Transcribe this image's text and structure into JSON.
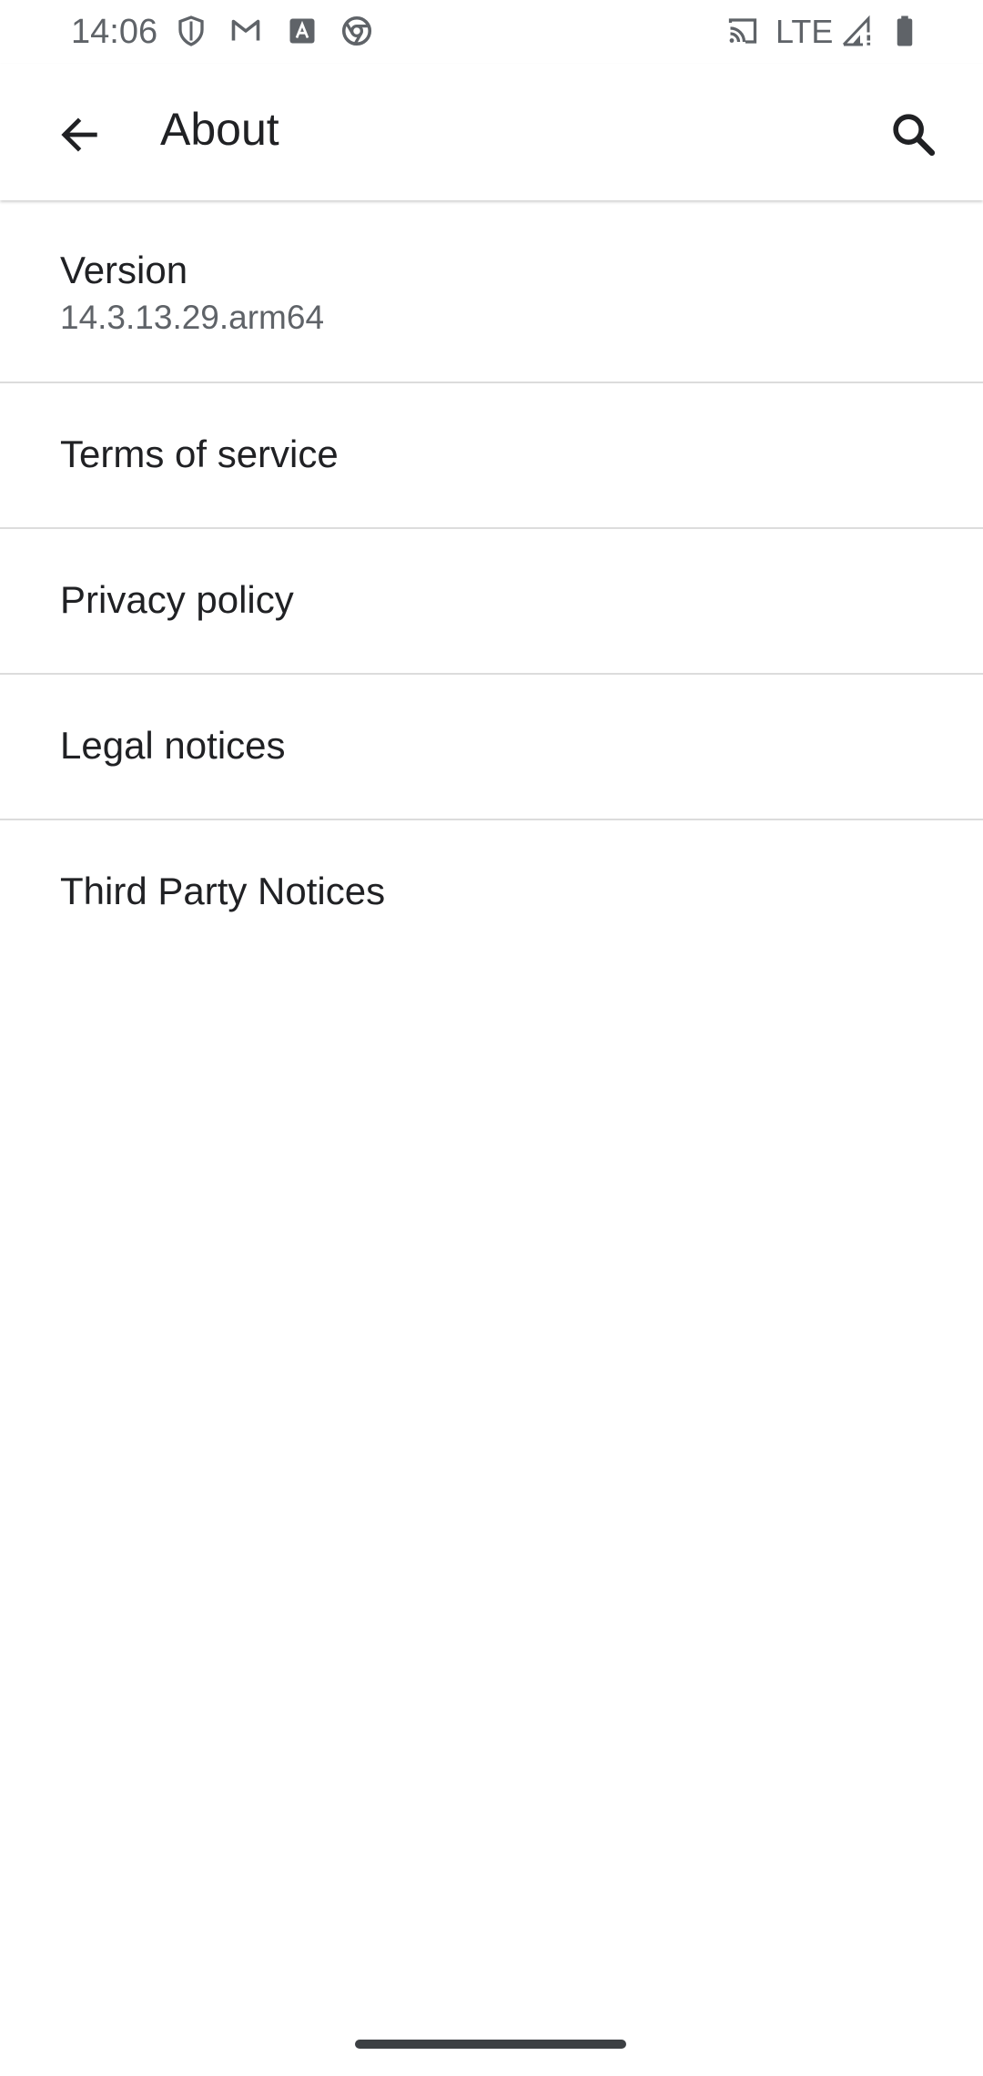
{
  "status_bar": {
    "time": "14:06",
    "network": "LTE",
    "notification_icons": [
      "shield-icon",
      "gmail-icon",
      "font-icon",
      "chrome-icon"
    ],
    "system_icons": [
      "cast-icon",
      "signal-icon",
      "battery-icon"
    ]
  },
  "app_bar": {
    "title": "About",
    "back_icon": "arrow-back-icon",
    "search_icon": "search-icon"
  },
  "items": [
    {
      "title": "Version",
      "subtitle": "14.3.13.29.arm64"
    },
    {
      "title": "Terms of service"
    },
    {
      "title": "Privacy policy"
    },
    {
      "title": "Legal notices"
    },
    {
      "title": "Third Party Notices"
    }
  ],
  "colors": {
    "primary_text": "#202124",
    "secondary_text": "#5f6368",
    "divider": "#dcdcdc"
  }
}
